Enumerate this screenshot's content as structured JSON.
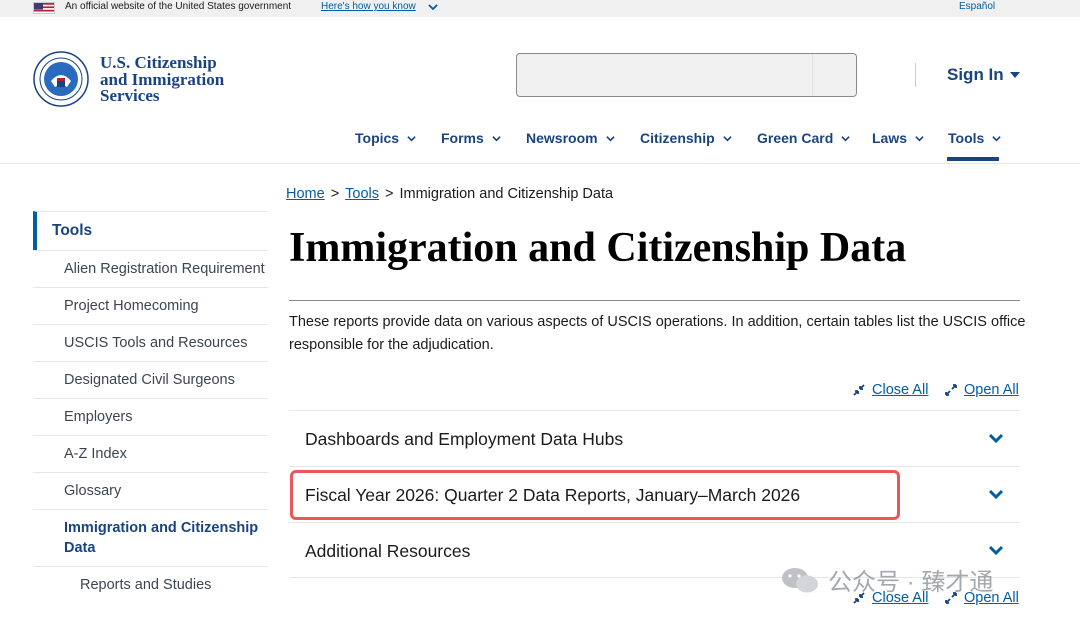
{
  "gov_banner": {
    "text": "An official website of the United States government",
    "link": "Here's how you know",
    "language": "Español"
  },
  "logo": {
    "line1": "U.S. Citizenship",
    "line2": "and Immigration",
    "line3": "Services"
  },
  "search": {
    "value": "",
    "placeholder": ""
  },
  "signin": {
    "label": "Sign In"
  },
  "nav": {
    "items": [
      {
        "label": "Topics"
      },
      {
        "label": "Forms"
      },
      {
        "label": "Newsroom"
      },
      {
        "label": "Citizenship"
      },
      {
        "label": "Green Card"
      },
      {
        "label": "Laws"
      },
      {
        "label": "Tools"
      }
    ],
    "active": "Tools"
  },
  "sidebar": {
    "title": "Tools",
    "items": [
      {
        "label": "Alien Registration Requirement"
      },
      {
        "label": "Project Homecoming"
      },
      {
        "label": "USCIS Tools and Resources"
      },
      {
        "label": "Designated Civil Surgeons"
      },
      {
        "label": "Employers"
      },
      {
        "label": "A-Z Index"
      },
      {
        "label": "Glossary"
      },
      {
        "label": "Immigration and Citizenship Data"
      },
      {
        "label": "Reports and Studies"
      }
    ]
  },
  "breadcrumb": {
    "home": "Home",
    "tools": "Tools",
    "separator": ">",
    "current": "Immigration and Citizenship Data"
  },
  "page": {
    "title": "Immigration and Citizenship Data",
    "intro": "These reports provide data on various aspects of USCIS operations. In addition, certain tables list the USCIS office responsible for the adjudication."
  },
  "accordion_controls": {
    "close_all": "Close All",
    "open_all": "Open All"
  },
  "accordion": {
    "items": [
      {
        "label": "Dashboards and Employment Data Hubs"
      },
      {
        "label": "Fiscal Year 2026: Quarter 2 Data Reports, January–March 2026"
      },
      {
        "label": "Additional Resources"
      }
    ]
  },
  "watermark": {
    "text": "公众号 · 臻才通"
  },
  "colors": {
    "brand": "#1a4480",
    "link": "#005ea2",
    "highlight": "#e8575a"
  }
}
